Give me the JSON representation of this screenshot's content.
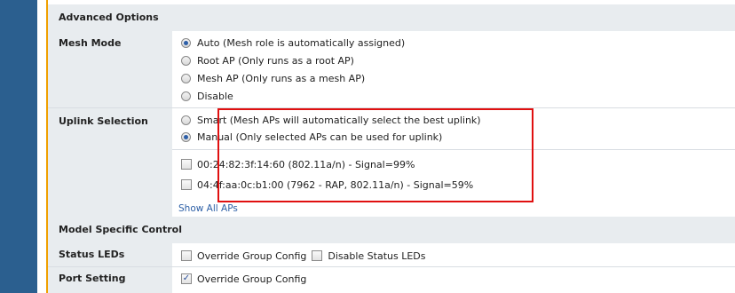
{
  "advanced_options": {
    "header": "Advanced Options",
    "mesh_mode": {
      "label": "Mesh Mode",
      "options": [
        {
          "label": "Auto (Mesh role is automatically assigned)",
          "checked": true
        },
        {
          "label": "Root AP (Only runs as a root AP)",
          "checked": false
        },
        {
          "label": "Mesh AP (Only runs as a mesh AP)",
          "checked": false
        },
        {
          "label": "Disable",
          "checked": false
        }
      ]
    },
    "uplink_selection": {
      "label": "Uplink Selection",
      "options": [
        {
          "label": "Smart (Mesh APs will automatically select the best uplink)",
          "checked": false
        },
        {
          "label": "Manual (Only selected APs can be used for uplink)",
          "checked": true
        }
      ],
      "aps": [
        {
          "label": "00:24:82:3f:14:60 (802.11a/n) - Signal=99%",
          "checked": false
        },
        {
          "label": "04:4f:aa:0c:b1:00 (7962 - RAP, 802.11a/n) - Signal=59%",
          "checked": false
        }
      ],
      "show_all_link": "Show All APs"
    }
  },
  "model_specific": {
    "header": "Model Specific Control",
    "status_leds": {
      "label": "Status LEDs",
      "override_label": "Override Group Config",
      "override_checked": false,
      "disable_label": "Disable Status LEDs",
      "disable_checked": false
    },
    "port_setting": {
      "label": "Port Setting",
      "override_label": "Override Group Config",
      "override_checked": true
    }
  },
  "colors": {
    "sidebar": "#2b5f8f",
    "accent": "#f0a000",
    "highlight_box": "#e01010",
    "link": "#2c5fa6"
  }
}
